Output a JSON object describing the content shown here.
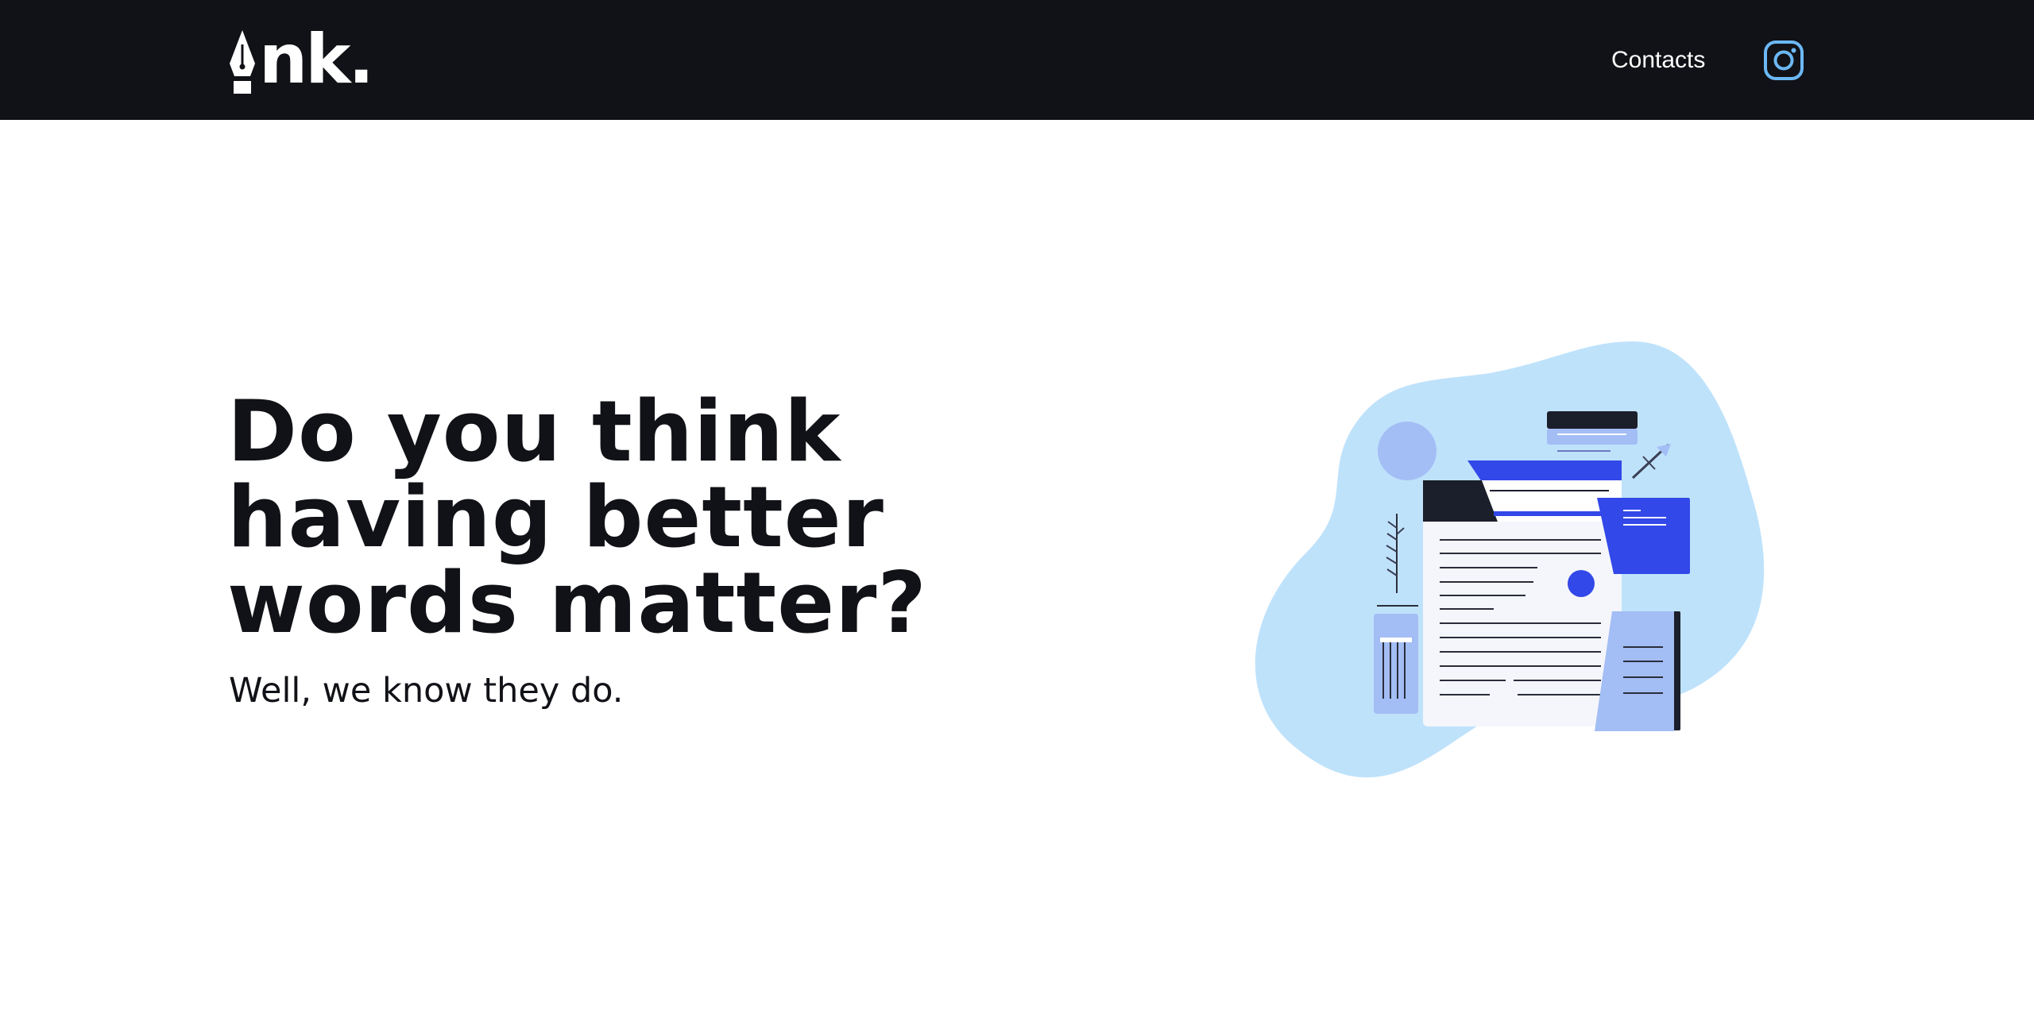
{
  "header": {
    "logo_text": "nk.",
    "logo_icon": "fountain-pen-nib-icon",
    "nav": {
      "contacts_label": "Contacts"
    },
    "social_icon": "instagram-icon"
  },
  "hero": {
    "headline_line1": "Do you think",
    "headline_line2": "having better",
    "headline_line3": "words matter?",
    "subheadline": "Well, we know they do."
  },
  "colors": {
    "header_bg": "#111217",
    "text_dark": "#111217",
    "accent_blue": "#3248e8",
    "light_blue": "#bfe2fb",
    "soft_blue": "#a3bdf5",
    "instagram_icon": "#6cb8f5"
  }
}
